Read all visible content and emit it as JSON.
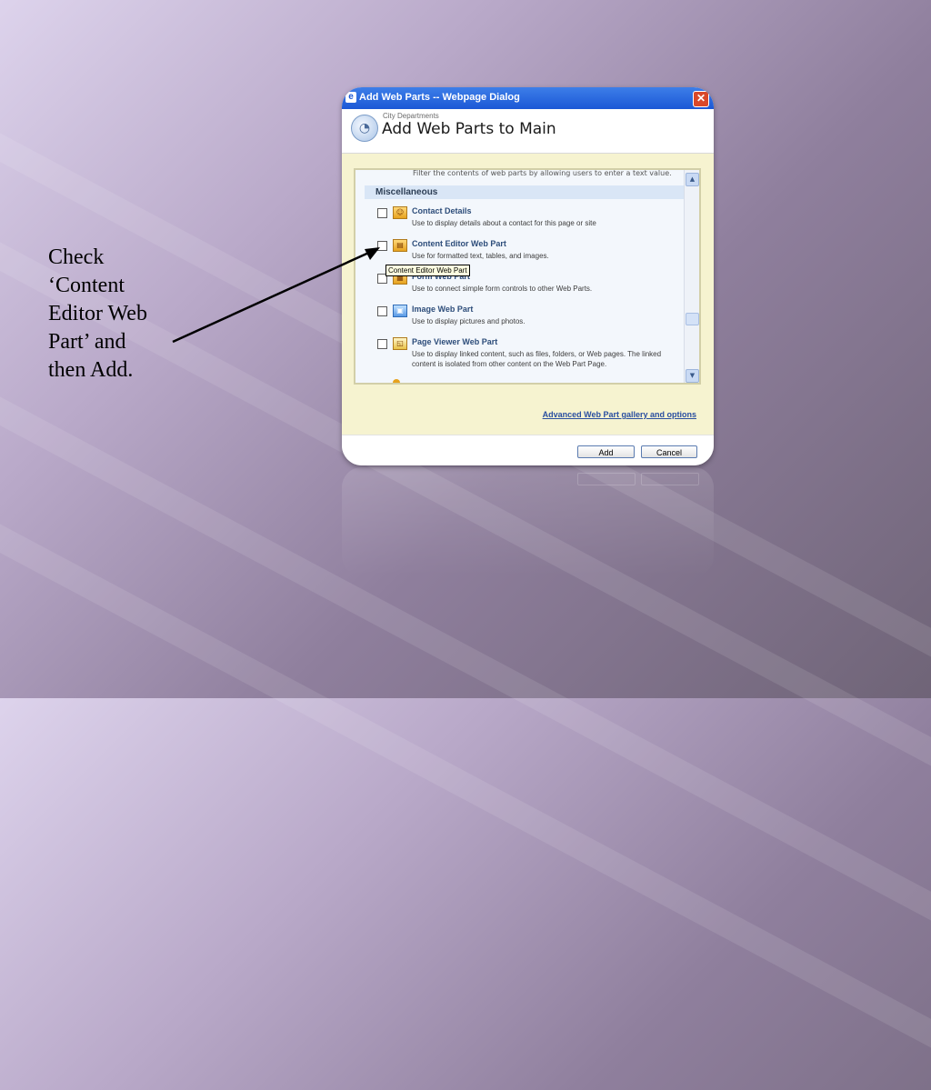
{
  "slide": {
    "instruction_lines": [
      "Check",
      "‘Content",
      "Editor Web",
      "Part’ and",
      "then Add."
    ]
  },
  "dialog": {
    "title": "Add Web Parts -- Webpage Dialog",
    "breadcrumb": "City Departments",
    "heading": "Add Web Parts to Main",
    "cutoff_description": "Filter the contents of web parts by allowing users to enter a text value.",
    "category": "Miscellaneous",
    "items": [
      {
        "name": "Contact Details",
        "description": "Use to display details about a contact for this page or site",
        "icon": "contact-icon",
        "checked": false
      },
      {
        "name": "Content Editor Web Part",
        "description": "Use for formatted text, tables, and images.",
        "icon": "content-editor-icon",
        "checked": false
      },
      {
        "name": "Form Web Part",
        "description": "Use to connect simple form controls to other Web Parts.",
        "icon": "form-icon",
        "checked": false
      },
      {
        "name": "Image Web Part",
        "description": "Use to display pictures and photos.",
        "icon": "image-icon",
        "checked": false
      },
      {
        "name": "Page Viewer Web Part",
        "description": "Use to display linked content, such as files, folders, or Web pages. The linked content is isolated from other content on the Web Part Page.",
        "icon": "page-viewer-icon",
        "checked": false
      }
    ],
    "tooltip": "Content Editor Web Part",
    "advanced_link": "Advanced Web Part gallery and options",
    "add_label": "Add",
    "cancel_label": "Cancel"
  },
  "colors": {
    "titlebar": "#1b58d6",
    "body_background": "#f6f3d0",
    "link": "#2a4fa0"
  }
}
